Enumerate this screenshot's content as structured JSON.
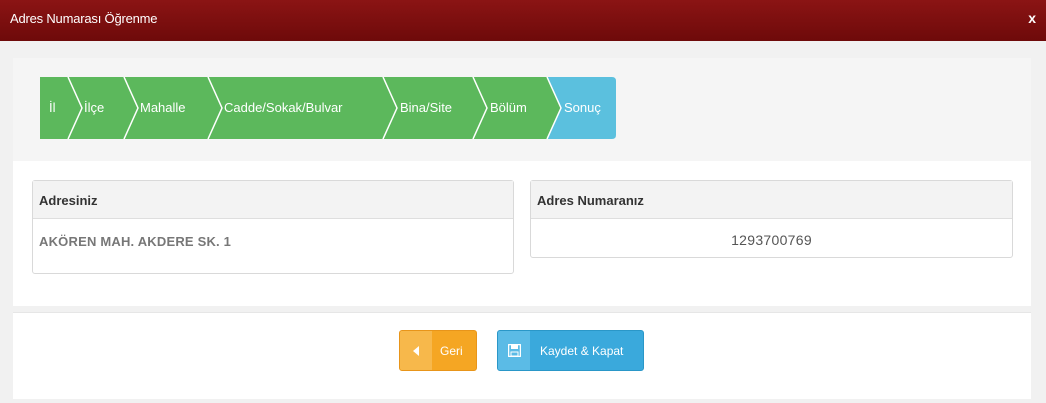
{
  "window": {
    "title": "Adres Numarası Öğrenme",
    "close_label": "x"
  },
  "wizard": {
    "steps": [
      {
        "label": "İl",
        "state": "done"
      },
      {
        "label": "İlçe",
        "state": "done"
      },
      {
        "label": "Mahalle",
        "state": "done"
      },
      {
        "label": "Cadde/Sokak/Bulvar",
        "state": "done"
      },
      {
        "label": "Bina/Site",
        "state": "done"
      },
      {
        "label": "Bölüm",
        "state": "done"
      },
      {
        "label": "Sonuç",
        "state": "active"
      }
    ],
    "colors": {
      "done": "#5cb85c",
      "active": "#5bc0de"
    }
  },
  "result": {
    "address_header": "Adresiniz",
    "address_value": "AKÖREN MAH. AKDERE SK. 1",
    "number_header": "Adres Numaranız",
    "number_value": "1293700769"
  },
  "footer": {
    "back_label": "Geri",
    "back_icon": "caret-left-icon",
    "save_label": "Kaydet & Kapat",
    "save_icon": "floppy-disk-icon"
  }
}
